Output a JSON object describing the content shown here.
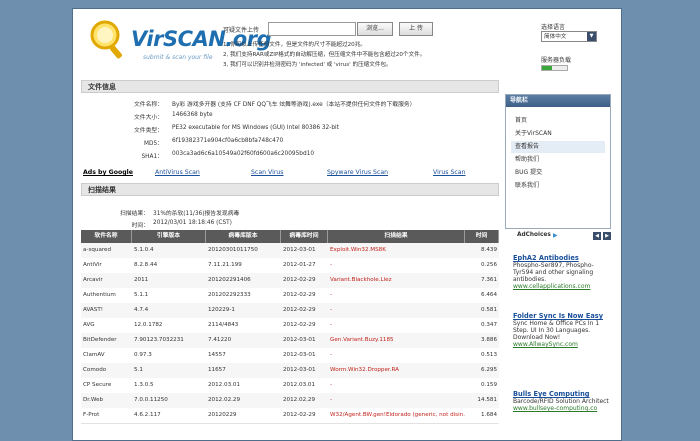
{
  "logo": {
    "title": "VirSCAN.org",
    "subtitle": "submit & scan your file"
  },
  "upload": {
    "label": "可疑文件上传",
    "browse": "浏览...",
    "submit": "上 传",
    "notes": [
      "1, 你可以上传任何文件，但是文件的尺寸不能超过20兆。",
      "2, 我们支持RAR或ZIP格式的自动解压缩，但压缩文件中不能包含超过20个文件。",
      "3, 我们可以识别并检测密码为 'infected' 或 'virus' 的压缩文件包。"
    ]
  },
  "language": {
    "label": "选择语言",
    "selected": "简体中文",
    "load_label": "服务器负载",
    "load_fraction": 0.4
  },
  "file_info": {
    "title": "文件信息",
    "rows": [
      {
        "key": "文件名称：",
        "value": "By彩 游戏多开器 (支持 CF DNF QQ飞车 炫舞等游戏).exe（本站不提供任何文件的下载服务）"
      },
      {
        "key": "文件大小：",
        "value": "1466368 byte"
      },
      {
        "key": "文件类型：",
        "value": "PE32 executable for MS Windows (GUI) Intel 80386 32-bit"
      },
      {
        "key": "MD5：",
        "value": "6f19382371e904cf0a6cb8bfa748c470"
      },
      {
        "key": "SHA1：",
        "value": "003ca3ad6c6a10549a02f60fd600a6c20095bd10"
      }
    ]
  },
  "nav": [
    "Ads by Google",
    "AntiVirus Scan",
    "Scan Virus",
    "Spyware Virus Scan",
    "Virus Scan"
  ],
  "scan": {
    "title": "扫描结果",
    "result_key": "扫描结果：",
    "result_val": "31%的杀软(11/36)报告发现病毒",
    "time_key": "时间：",
    "time_val": "2012/03/01 18:18:46 (CST)",
    "columns": [
      "软件名称",
      "引擎版本",
      "病毒库版本",
      "病毒库时间",
      "扫描结果",
      "时间"
    ],
    "rows": [
      [
        "a-squared",
        "5.1.0.4",
        "20120301011750",
        "2012-03-01",
        "Exploit.Win32.MS8K",
        "8.439"
      ],
      [
        "AntiVir",
        "8.2.8.44",
        "7.11.21.199",
        "2012-01-27",
        "-",
        "0.256"
      ],
      [
        "Arcavir",
        "2011",
        "201202291406",
        "2012-02-29",
        "Variant.Blackhole.Llez",
        "7.361"
      ],
      [
        "Authentium",
        "5.1.1",
        "201202292333",
        "2012-02-29",
        "-",
        "6.464"
      ],
      [
        "AVAST!",
        "4.7.4",
        "120229-1",
        "2012-02-29",
        "-",
        "0.581"
      ],
      [
        "AVG",
        "12.0.1782",
        "2114/4843",
        "2012-02-29",
        "-",
        "0.347"
      ],
      [
        "BitDefender",
        "7.90123.7032231",
        "7.41220",
        "2012-03-01",
        "Gen.Variant.Buzy.1185",
        "3.886"
      ],
      [
        "ClamAV",
        "0.97.3",
        "14557",
        "2012-03-01",
        "-",
        "0.513"
      ],
      [
        "Comodo",
        "5.1",
        "11657",
        "2012-03-01",
        "Worm.Win32.Dropper.RA",
        "6.295"
      ],
      [
        "CP Secure",
        "1.3.0.5",
        "2012.03.01",
        "2012.03.01",
        "-",
        "0.159"
      ],
      [
        "Dr.Web",
        "7.0.0.11250",
        "2012.02.29",
        "2012.02.29",
        "-",
        "14.581"
      ],
      [
        "F-Prot",
        "4.6.2.117",
        "20120229",
        "2012-02-29",
        "W32/Agent.BW.gen!Eldorado (generic, not disin...",
        "1.684"
      ]
    ]
  },
  "sidebar": {
    "title": "导航栏",
    "items": [
      "首页",
      "关于VirSCAN",
      "查看报告",
      "帮助我们",
      "BUG 提交",
      "联系我们"
    ]
  },
  "ads": {
    "adchoices": "AdChoices",
    "items": [
      {
        "title": "EphA2 Antibodies",
        "body": "Phospho-Ser897, Phospho-Tyr594 and other signaling antibodies.",
        "url": "www.cellapplications.com"
      },
      {
        "title": "Folder Sync Is Now Easy",
        "body": "Sync Home & Office PCs In 1 Step. UI In 30 Languages. Download Now!",
        "url": "www.AllwaySync.com"
      },
      {
        "title": "Bulls Eye Computing",
        "body": "Barcode/RFID Solution Architect",
        "url": "www.bullseye-computing.co"
      }
    ]
  },
  "colors": {
    "background": "#6f8fae",
    "header_dark": "#5a5a5a",
    "link": "#1a4f9a",
    "virus_red": "#c0221b"
  }
}
